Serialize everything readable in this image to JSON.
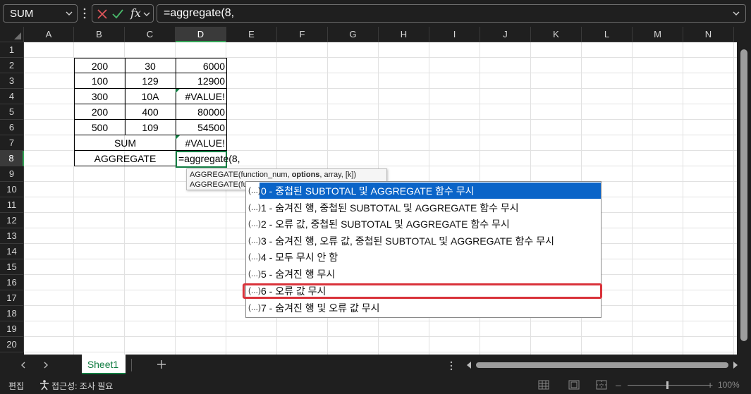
{
  "formula_bar": {
    "name_box": "SUM",
    "fx_label": "fx",
    "formula": "=aggregate(8,"
  },
  "columns": [
    "A",
    "B",
    "C",
    "D",
    "E",
    "F",
    "G",
    "H",
    "I",
    "J",
    "K",
    "L",
    "M",
    "N"
  ],
  "selected_column": "D",
  "rows": [
    "1",
    "2",
    "3",
    "4",
    "5",
    "6",
    "7",
    "8",
    "9",
    "10",
    "11",
    "12",
    "13",
    "14",
    "15",
    "16",
    "17",
    "18",
    "19",
    "20"
  ],
  "selected_row": "8",
  "table": {
    "r2": [
      "200",
      "30",
      "6000"
    ],
    "r3": [
      "100",
      "129",
      "12900"
    ],
    "r4": [
      "300",
      "10A",
      "#VALUE!"
    ],
    "r5": [
      "200",
      "400",
      "80000"
    ],
    "r6": [
      "500",
      "109",
      "54500"
    ],
    "sum_label": "SUM",
    "sum_value": "#VALUE!",
    "aggregate_label": "AGGREGATE"
  },
  "active_cell_text": "=aggregate(8,",
  "tooltip": {
    "line1_pre": "AGGREGATE(function_num, ",
    "line1_bold": "options",
    "line1_post": ", array, [k])",
    "line2": "AGGREGATE(fu"
  },
  "autocomplete": {
    "prefix": "(...)",
    "items": [
      "0 - 중첩된 SUBTOTAL 및 AGGREGATE 함수 무시",
      "1 - 숨겨진 행, 중첩된 SUBTOTAL 및 AGGREGATE 함수 무시",
      "2 - 오류 값, 중첩된 SUBTOTAL 및 AGGREGATE 함수 무시",
      "3 - 숨겨진 행, 오류 값, 중첩된 SUBTOTAL 및 AGGREGATE 함수 무시",
      "4 - 모두 무시 안 함",
      "5 - 숨겨진 행 무시",
      "6 - 오류 값 무시",
      "7 - 숨겨진 행 및 오류 값 무시"
    ],
    "selected_index": 0,
    "highlighted_index": 6,
    "highlight_color": "#d9323a",
    "selection_color": "#0a64c8"
  },
  "sheet_tab": "Sheet1",
  "status": {
    "mode": "편집",
    "accessibility": "접근성: 조사 필요",
    "zoom": "100%"
  },
  "colors": {
    "accent": "#107c41",
    "background": "#1f1f1f"
  }
}
